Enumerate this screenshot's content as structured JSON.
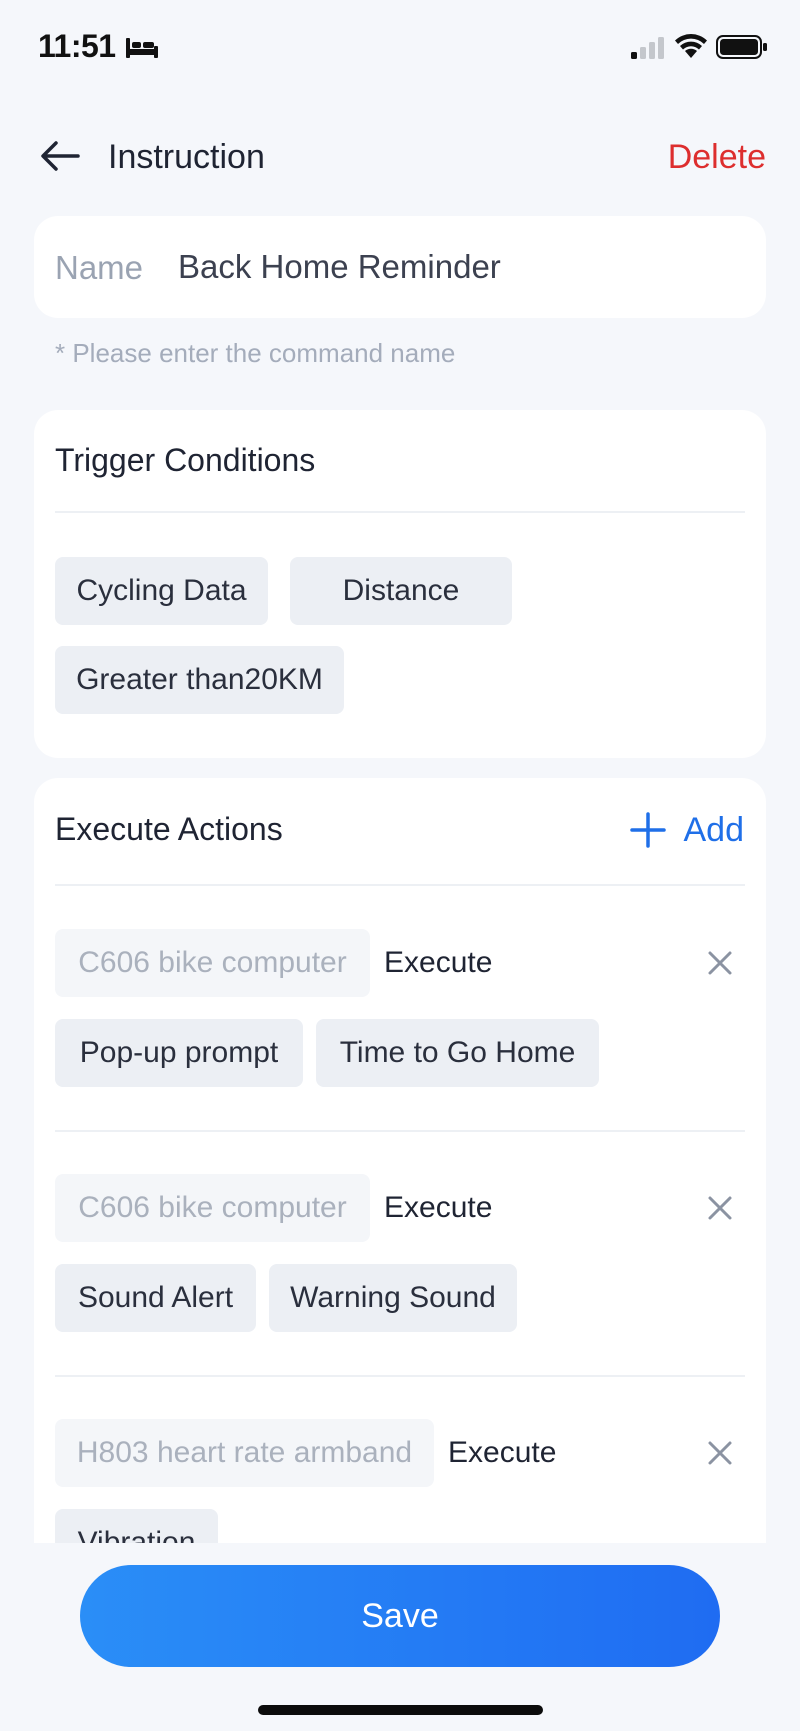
{
  "status_bar": {
    "time": "11:51"
  },
  "header": {
    "title": "Instruction",
    "delete_label": "Delete"
  },
  "name_field": {
    "label": "Name",
    "value": "Back Home Reminder",
    "hint": "* Please enter the command name"
  },
  "trigger": {
    "title": "Trigger Conditions",
    "chips": [
      "Cycling Data",
      "Distance",
      "Greater than20KM"
    ]
  },
  "actions": {
    "title": "Execute Actions",
    "add_label": "Add",
    "items": [
      {
        "device": "C606 bike computer",
        "verb": "Execute",
        "chips": [
          "Pop-up prompt",
          "Time to Go Home"
        ]
      },
      {
        "device": "C606 bike computer",
        "verb": "Execute",
        "chips": [
          "Sound Alert",
          "Warning Sound"
        ]
      },
      {
        "device": "H803 heart rate armband",
        "verb": "Execute",
        "chips": [
          "Vibration"
        ]
      }
    ]
  },
  "save_label": "Save",
  "colors": {
    "accent": "#1f6fe8",
    "danger": "#dd2e2e",
    "chip_bg": "#eceff4",
    "page_bg": "#f5f7fb"
  }
}
